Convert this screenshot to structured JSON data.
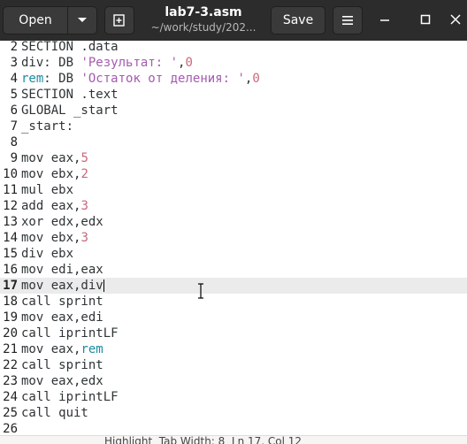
{
  "header": {
    "open_label": "Open",
    "save_label": "Save",
    "title": "lab7-3.asm",
    "subtitle": "~/work/study/202..."
  },
  "editor": {
    "current_line": 17,
    "lines": [
      {
        "n": "2",
        "tokens": [
          {
            "t": "SECTION .data",
            "c": "kw"
          }
        ]
      },
      {
        "n": "3",
        "tokens": [
          {
            "t": "div: DB ",
            "c": "kw"
          },
          {
            "t": "'Результат: '",
            "c": "str"
          },
          {
            "t": ",",
            "c": "kw"
          },
          {
            "t": "0",
            "c": "num"
          }
        ]
      },
      {
        "n": "4",
        "tokens": [
          {
            "t": "rem",
            "c": "lbl"
          },
          {
            "t": ": DB ",
            "c": "kw"
          },
          {
            "t": "'Остаток от деления: '",
            "c": "str"
          },
          {
            "t": ",",
            "c": "kw"
          },
          {
            "t": "0",
            "c": "num"
          }
        ]
      },
      {
        "n": "5",
        "tokens": [
          {
            "t": "SECTION .text",
            "c": "kw"
          }
        ]
      },
      {
        "n": "6",
        "tokens": [
          {
            "t": "GLOBAL _start",
            "c": "kw"
          }
        ]
      },
      {
        "n": "7",
        "tokens": [
          {
            "t": "_start:",
            "c": "kw"
          }
        ]
      },
      {
        "n": "8",
        "tokens": []
      },
      {
        "n": "9",
        "tokens": [
          {
            "t": "mov eax,",
            "c": "kw"
          },
          {
            "t": "5",
            "c": "num"
          }
        ]
      },
      {
        "n": "10",
        "tokens": [
          {
            "t": "mov ebx,",
            "c": "kw"
          },
          {
            "t": "2",
            "c": "num"
          }
        ]
      },
      {
        "n": "11",
        "tokens": [
          {
            "t": "mul ebx",
            "c": "kw"
          }
        ]
      },
      {
        "n": "12",
        "tokens": [
          {
            "t": "add eax,",
            "c": "kw"
          },
          {
            "t": "3",
            "c": "num"
          }
        ]
      },
      {
        "n": "13",
        "tokens": [
          {
            "t": "xor edx,edx",
            "c": "kw"
          }
        ]
      },
      {
        "n": "14",
        "tokens": [
          {
            "t": "mov ebx,",
            "c": "kw"
          },
          {
            "t": "3",
            "c": "num"
          }
        ]
      },
      {
        "n": "15",
        "tokens": [
          {
            "t": "div ebx",
            "c": "kw"
          }
        ]
      },
      {
        "n": "16",
        "tokens": [
          {
            "t": "mov edi,eax",
            "c": "kw"
          }
        ]
      },
      {
        "n": "17",
        "tokens": [
          {
            "t": "mov eax,div",
            "c": "kw"
          }
        ]
      },
      {
        "n": "18",
        "tokens": [
          {
            "t": "call sprint",
            "c": "kw"
          }
        ]
      },
      {
        "n": "19",
        "tokens": [
          {
            "t": "mov eax,edi",
            "c": "kw"
          }
        ]
      },
      {
        "n": "20",
        "tokens": [
          {
            "t": "call iprintLF",
            "c": "kw"
          }
        ]
      },
      {
        "n": "21",
        "tokens": [
          {
            "t": "mov eax,",
            "c": "kw"
          },
          {
            "t": "rem",
            "c": "lbl"
          }
        ]
      },
      {
        "n": "22",
        "tokens": [
          {
            "t": "call sprint",
            "c": "kw"
          }
        ]
      },
      {
        "n": "23",
        "tokens": [
          {
            "t": "mov eax,edx",
            "c": "kw"
          }
        ]
      },
      {
        "n": "24",
        "tokens": [
          {
            "t": "call iprintLF",
            "c": "kw"
          }
        ]
      },
      {
        "n": "25",
        "tokens": [
          {
            "t": "call quit",
            "c": "kw"
          }
        ]
      },
      {
        "n": "26",
        "tokens": []
      }
    ]
  },
  "statusbar": {
    "text": "Highlight  Tab Width: 8  Ln 17, Col 12"
  }
}
